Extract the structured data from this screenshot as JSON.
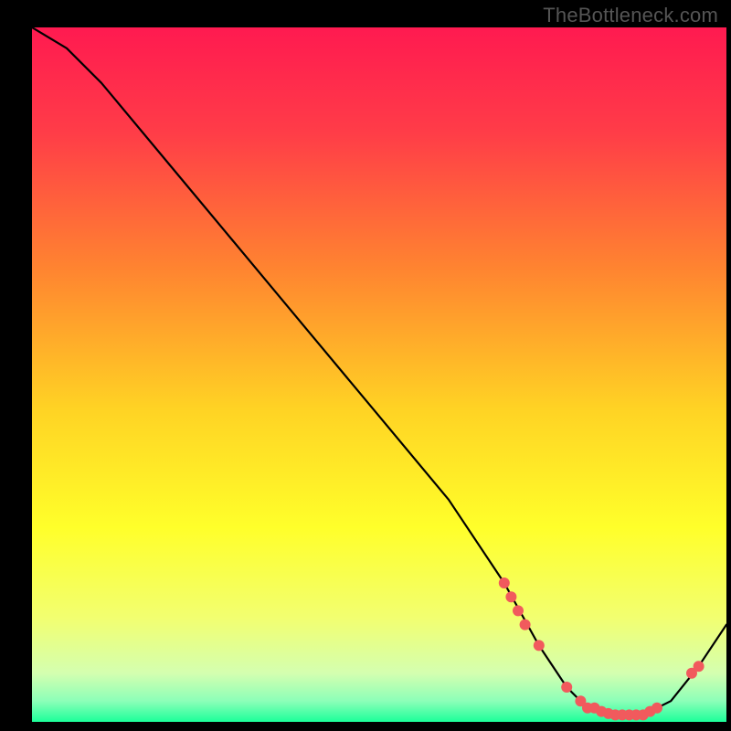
{
  "watermark": "TheBottleneck.com",
  "chart_data": {
    "type": "line",
    "title": "",
    "xlabel": "",
    "ylabel": "",
    "xlim": [
      0,
      100
    ],
    "ylim": [
      0,
      100
    ],
    "grid": false,
    "legend": false,
    "background_gradient": {
      "stops": [
        {
          "pos": 0.0,
          "color": "#ff1a50"
        },
        {
          "pos": 0.15,
          "color": "#ff3c48"
        },
        {
          "pos": 0.35,
          "color": "#ff8530"
        },
        {
          "pos": 0.55,
          "color": "#ffd324"
        },
        {
          "pos": 0.72,
          "color": "#ffff2a"
        },
        {
          "pos": 0.85,
          "color": "#f2ff70"
        },
        {
          "pos": 0.93,
          "color": "#d4ffb0"
        },
        {
          "pos": 0.97,
          "color": "#8cffb8"
        },
        {
          "pos": 1.0,
          "color": "#1cff9a"
        }
      ]
    },
    "series": [
      {
        "name": "bottleneck-curve",
        "x": [
          0,
          5,
          10,
          20,
          30,
          40,
          50,
          60,
          68,
          73,
          77,
          80,
          84,
          88,
          92,
          96,
          100
        ],
        "y": [
          100,
          97,
          92,
          80,
          68,
          56,
          44,
          32,
          20,
          11,
          5,
          2,
          1,
          1,
          3,
          8,
          14
        ]
      }
    ],
    "markers": {
      "name": "bottleneck-markers",
      "points": [
        {
          "x": 68,
          "y": 20
        },
        {
          "x": 69,
          "y": 18
        },
        {
          "x": 70,
          "y": 16
        },
        {
          "x": 71,
          "y": 14
        },
        {
          "x": 73,
          "y": 11
        },
        {
          "x": 77,
          "y": 5
        },
        {
          "x": 79,
          "y": 3
        },
        {
          "x": 80,
          "y": 2
        },
        {
          "x": 81,
          "y": 2
        },
        {
          "x": 82,
          "y": 1.5
        },
        {
          "x": 83,
          "y": 1.2
        },
        {
          "x": 84,
          "y": 1
        },
        {
          "x": 85,
          "y": 1
        },
        {
          "x": 86,
          "y": 1
        },
        {
          "x": 87,
          "y": 1
        },
        {
          "x": 88,
          "y": 1
        },
        {
          "x": 89,
          "y": 1.5
        },
        {
          "x": 90,
          "y": 2
        },
        {
          "x": 95,
          "y": 7
        },
        {
          "x": 96,
          "y": 8
        }
      ]
    }
  }
}
